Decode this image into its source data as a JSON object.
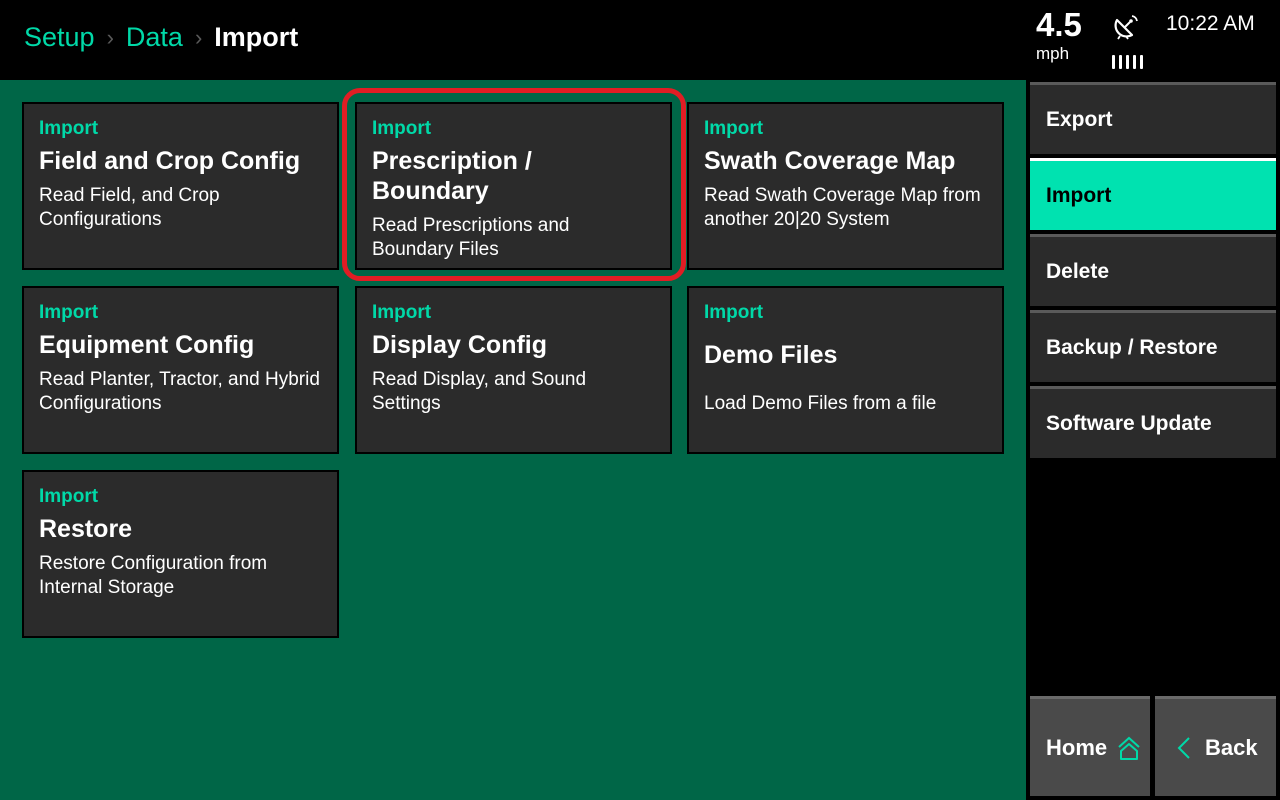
{
  "header": {
    "breadcrumb": [
      {
        "label": "Setup"
      },
      {
        "label": "Data"
      },
      {
        "label": "Import"
      }
    ],
    "separator": "›",
    "speed": {
      "value": "4.5",
      "unit": "mph"
    },
    "gps": {
      "icon": "satellite-dish-icon",
      "signal_bars": 5
    },
    "clock": "10:22 AM"
  },
  "tiles": [
    {
      "kicker": "Import",
      "title": "Field and Crop Config",
      "desc": "Read Field, and Crop Configurations"
    },
    {
      "kicker": "Import",
      "title": "Prescription / Boundary",
      "desc": "Read Prescriptions and Boundary Files",
      "highlighted": true
    },
    {
      "kicker": "Import",
      "title": "Swath Coverage Map",
      "desc": "Read Swath Coverage Map from another 20|20 System"
    },
    {
      "kicker": "Import",
      "title": "Equipment Config",
      "desc": "Read Planter, Tractor, and Hybrid Configurations"
    },
    {
      "kicker": "Import",
      "title": "Display Config",
      "desc": "Read Display, and Sound Settings"
    },
    {
      "kicker": "Import",
      "title": "Demo Files",
      "desc": "Load Demo Files from a file"
    },
    {
      "kicker": "Import",
      "title": "Restore",
      "desc": "Restore Configuration from Internal Storage"
    }
  ],
  "sidebar": {
    "items": [
      {
        "label": "Export"
      },
      {
        "label": "Import",
        "active": true
      },
      {
        "label": "Delete"
      },
      {
        "label": "Backup / Restore"
      },
      {
        "label": "Software Update"
      }
    ],
    "home_label": "Home",
    "back_label": "Back"
  },
  "colors": {
    "accent": "#00d9a8",
    "active_bg": "#00e2b0",
    "panel_bg": "#006647",
    "tile_bg": "#2b2b2b",
    "highlight": "#e11d24"
  }
}
